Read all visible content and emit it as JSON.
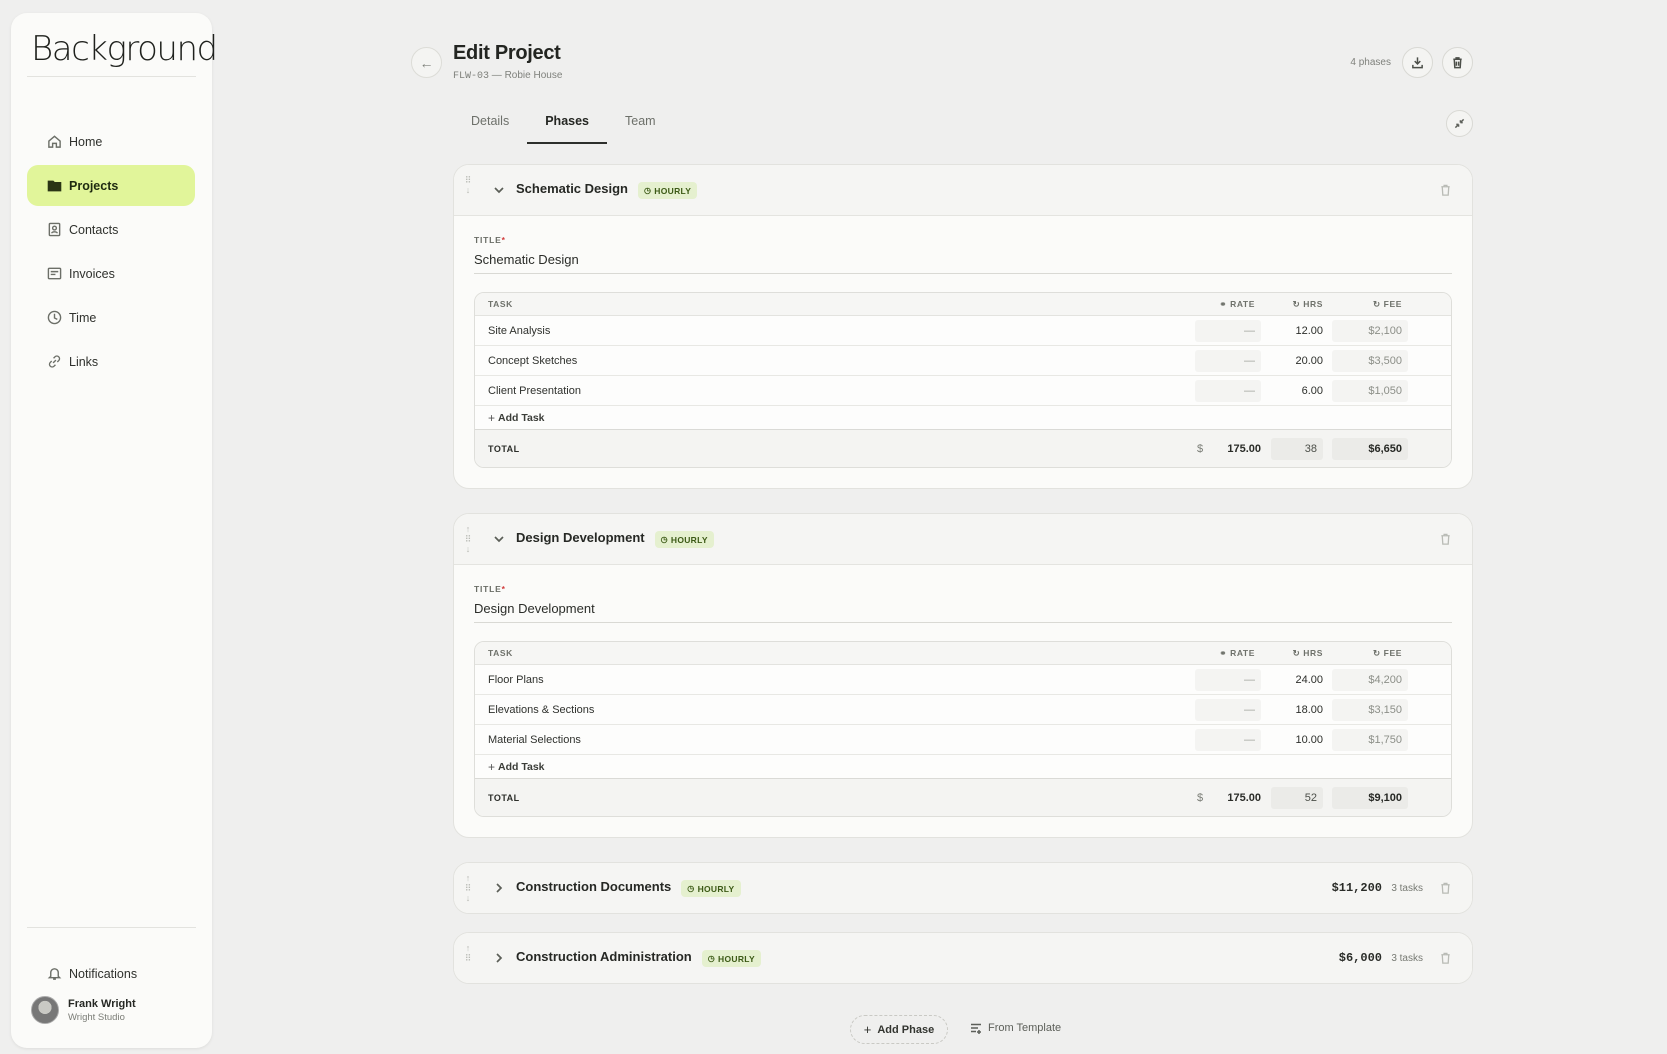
{
  "app": {
    "logo": "Background"
  },
  "sidebar": {
    "items": [
      {
        "label": "Home",
        "icon": "home-icon",
        "active": false
      },
      {
        "label": "Projects",
        "icon": "folder-icon",
        "active": true
      },
      {
        "label": "Contacts",
        "icon": "contacts-icon",
        "active": false
      },
      {
        "label": "Invoices",
        "icon": "invoice-icon",
        "active": false
      },
      {
        "label": "Time",
        "icon": "clock-icon",
        "active": false
      },
      {
        "label": "Links",
        "icon": "link-icon",
        "active": false
      }
    ],
    "notifications_label": "Notifications",
    "user": {
      "name": "Frank Wright",
      "org": "Wright Studio"
    }
  },
  "header": {
    "title": "Edit Project",
    "code": "FLW-03",
    "subtitle_rest": " — Robie House",
    "phase_count": "4 phases"
  },
  "tabs": [
    {
      "label": "Details",
      "active": false
    },
    {
      "label": "Phases",
      "active": true
    },
    {
      "label": "Team",
      "active": false
    }
  ],
  "table_headers": {
    "task": "TASK",
    "rate": "RATE",
    "hrs": "HRS",
    "fee": "FEE",
    "total": "TOTAL",
    "currency": "$"
  },
  "labels": {
    "title_field": "TITLE",
    "required_mark": "*",
    "add_task": "Add Task",
    "badge_hourly": "HOURLY"
  },
  "phases": [
    {
      "name": "Schematic Design",
      "title_value": "Schematic Design",
      "tasks": [
        {
          "name": "Site Analysis",
          "rate": "—",
          "hrs": "12.00",
          "fee": "$2,100"
        },
        {
          "name": "Concept Sketches",
          "rate": "—",
          "hrs": "20.00",
          "fee": "$3,500"
        },
        {
          "name": "Client Presentation",
          "rate": "—",
          "hrs": "6.00",
          "fee": "$1,050"
        }
      ],
      "total": {
        "rate": "175.00",
        "hrs": "38",
        "fee": "$6,650"
      }
    },
    {
      "name": "Design Development",
      "title_value": "Design Development",
      "tasks": [
        {
          "name": "Floor Plans",
          "rate": "—",
          "hrs": "24.00",
          "fee": "$4,200"
        },
        {
          "name": "Elevations & Sections",
          "rate": "—",
          "hrs": "18.00",
          "fee": "$3,150"
        },
        {
          "name": "Material Selections",
          "rate": "—",
          "hrs": "10.00",
          "fee": "$1,750"
        }
      ],
      "total": {
        "rate": "175.00",
        "hrs": "52",
        "fee": "$9,100"
      }
    },
    {
      "name": "Construction Documents",
      "total_fee": "$11,200",
      "tasks_count": "3 tasks"
    },
    {
      "name": "Construction Administration",
      "total_fee": "$6,000",
      "tasks_count": "3 tasks"
    }
  ],
  "actions": {
    "add_phase": "Add Phase",
    "from_template": "From Template"
  },
  "colors": {
    "accent": "#e1f59a",
    "badge_bg": "#e5f0cf",
    "badge_text": "#3c5a16"
  }
}
